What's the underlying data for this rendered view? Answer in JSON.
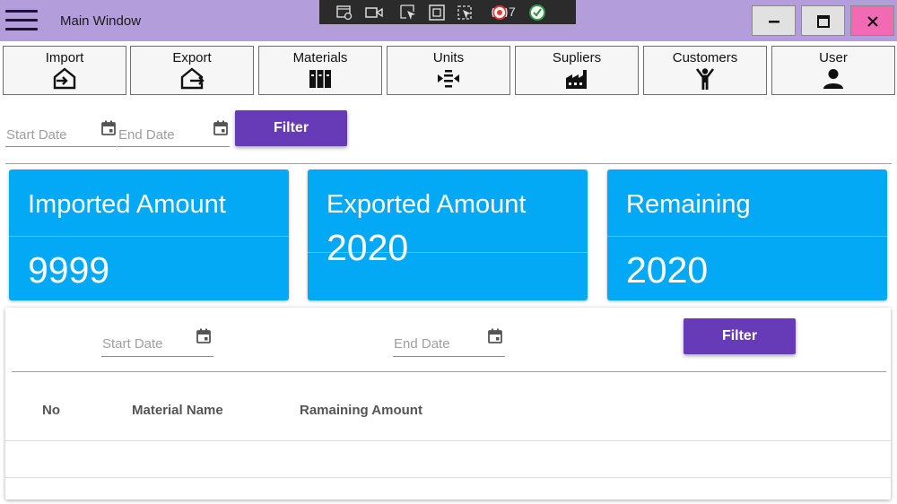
{
  "window": {
    "title": "Main Window",
    "titlebar_color": "#b39ddb",
    "close_button_color": "#f06bb3"
  },
  "dev_toolbar": {
    "binding_error_count": "7"
  },
  "nav": [
    {
      "label": "Import",
      "icon": "import-icon"
    },
    {
      "label": "Export",
      "icon": "export-icon"
    },
    {
      "label": "Materials",
      "icon": "materials-icon"
    },
    {
      "label": "Units",
      "icon": "units-icon"
    },
    {
      "label": "Supliers",
      "icon": "factory-icon"
    },
    {
      "label": "Customers",
      "icon": "person-arms-up-icon"
    },
    {
      "label": "User",
      "icon": "user-icon"
    }
  ],
  "top_filter": {
    "start_placeholder": "Start Date",
    "end_placeholder": "End Date",
    "button_label": "Filter"
  },
  "cards": [
    {
      "title": "Imported Amount",
      "value": "9999"
    },
    {
      "title": "Exported Amount",
      "value": "2020"
    },
    {
      "title": "Remaining",
      "value": "2020"
    }
  ],
  "card_color": "#03a9f4",
  "accent_color": "#673ab7",
  "table_filter": {
    "start_placeholder": "Start Date",
    "end_placeholder": "End Date",
    "button_label": "Filter"
  },
  "table": {
    "columns": [
      "No",
      "Material Name",
      "Ramaining Amount"
    ],
    "rows": []
  }
}
